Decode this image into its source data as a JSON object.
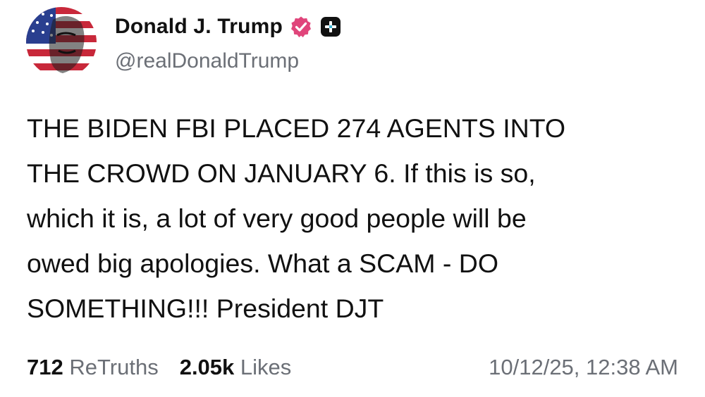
{
  "post": {
    "author": {
      "display_name": "Donald J. Trump",
      "handle": "@realDonaldTrump",
      "verified_icon": "verified-badge-icon",
      "verified_color": "#e0457b",
      "plus_icon": "add-plus-icon"
    },
    "text": "THE BIDEN FBI PLACED 274 AGENTS INTO\nTHE CROWD ON JANUARY 6. If this is so,\nwhich it is, a lot of very good people will be\nowed big apologies. What a SCAM - DO\nSOMETHING!!! President DJT",
    "stats": {
      "retruths_count": "712",
      "retruths_label": "ReTruths",
      "likes_count": "2.05k",
      "likes_label": "Likes"
    },
    "timestamp": "10/12/25, 12:38 AM"
  },
  "colors": {
    "text": "#111111",
    "muted": "#6b6f76",
    "accent": "#e0457b"
  }
}
